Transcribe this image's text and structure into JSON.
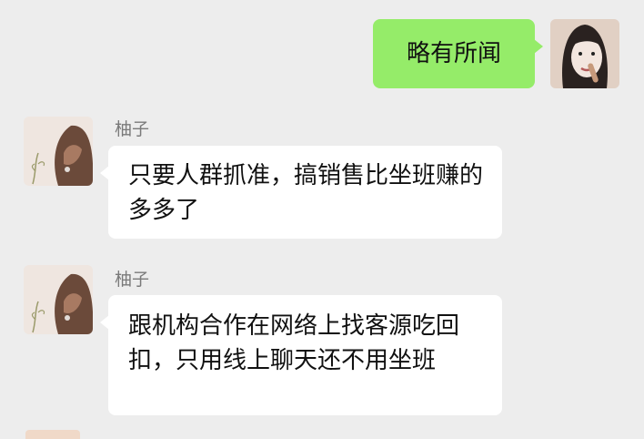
{
  "messages": [
    {
      "side": "out",
      "text": "略有所闻",
      "avatar": "user-self-avatar-icon"
    },
    {
      "side": "in",
      "sender": "柚子",
      "text": "只要人群抓准，搞销售比坐班赚的多多了",
      "avatar": "contact-youzi-avatar-icon"
    },
    {
      "side": "in",
      "sender": "柚子",
      "text": "跟机构合作在网络上找客源吃回扣，只用线上聊天还不用坐班",
      "avatar": "contact-youzi-avatar-icon"
    }
  ],
  "colors": {
    "background": "#ededed",
    "outgoing_bubble": "#95ec69",
    "incoming_bubble": "#ffffff",
    "sender_name": "#7a7a7a"
  }
}
